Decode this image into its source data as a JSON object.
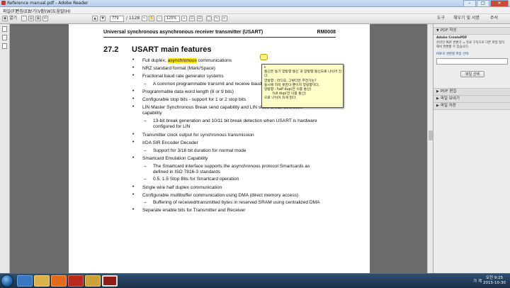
{
  "window": {
    "title": "Reference manual.pdf - Adobe Reader"
  },
  "menu": [
    "파일(F)",
    "편집(E)",
    "보기(V)",
    "창(W)",
    "도움말(H)"
  ],
  "toolbar": {
    "open_label": "열기",
    "page_current": "779",
    "page_total": "/ 1128",
    "zoom": "125%",
    "tools": "도구",
    "sign": "채우기 및 서명",
    "comment": "주석"
  },
  "document": {
    "header_left": "Universal synchronous asynchronous receiver transmitter (USART)",
    "header_right": "RM0008",
    "section_number": "27.2",
    "section_title": "USART main features",
    "items": [
      {
        "type": "bullet",
        "pre": "Full duplex, ",
        "highlight": "asynchronous",
        "post": " communications"
      },
      {
        "type": "bullet",
        "text": "NRZ standard format (Mark/Space)"
      },
      {
        "type": "bullet",
        "text": "Fractional baud rate generator systems"
      },
      {
        "type": "dash",
        "text": "A common programmable transmit and receive baud rate"
      },
      {
        "type": "bullet",
        "text": "Programmable data word length (8 or 9 bits)"
      },
      {
        "type": "bullet",
        "text": "Configurable stop bits - support for 1 or 2 stop bits"
      },
      {
        "type": "bullet",
        "text": "LIN Master Synchronous Break send capability and LIN slave break detection"
      },
      {
        "type": "cont",
        "text": "capability"
      },
      {
        "type": "dash",
        "text": "13-bit break generation and 10/11 bit break detection when USART is hardware"
      },
      {
        "type": "cont2",
        "text": "configured for LIN"
      },
      {
        "type": "bullet",
        "text": "Transmitter clock output for synchronous transmission"
      },
      {
        "type": "bullet",
        "text": "IrDA SIR Encoder Decoder"
      },
      {
        "type": "dash",
        "text": "Support for 3/16 bit duration for normal mode"
      },
      {
        "type": "bullet",
        "text": "Smartcard Emulation Capability"
      },
      {
        "type": "dash",
        "text": "The Smartcard interface supports the asynchronous protocol Smartcards as"
      },
      {
        "type": "cont2",
        "text": "defined in ISO 7816-3 standards"
      },
      {
        "type": "dash",
        "text": "0.5, 1.5 Stop Bits for Smartcard operation"
      },
      {
        "type": "bullet",
        "text": "Single wire half duplex communication"
      },
      {
        "type": "bullet",
        "text": "Configurable multibuffer communication using DMA (direct memory access)"
      },
      {
        "type": "dash",
        "text": "Buffering of received/transmitted bytes in reserved SRAM using centralized DMA"
      },
      {
        "type": "bullet",
        "text": "Separate enable bits for Transmitter and Receiver"
      }
    ]
  },
  "note_popup": {
    "author": "k",
    "line1": "통신은 동기 양방향 통신 과 양방향 통신으로 나뉘어 진다.",
    "line2": "양방향 : 라디오, 그렇다면 무전기는?",
    "line3": "동시에 하지 못한다 뿐이지 양방향이다.",
    "line4": "양방향 : half dup(전 이중 통신)",
    "line5": "full dup(전 이중 통신)",
    "line6": "으로 나뉘어 지게 된다."
  },
  "right_panel": {
    "tabs": [
      "도구",
      "채우기 및 서명",
      "주석"
    ],
    "pdf_create": "PDF 작성",
    "adobe_createpdf": "Adobe CreatePDF",
    "create_desc": "온라인 PDF 변환기 = 유료 구독으로 다른 파일 형식 에서 변환할 수 있습니다.",
    "select_label": "PDF로 변환할 파일 선택:",
    "select_button": "파일 선택",
    "pdf_edit": "PDF 편집",
    "file_send": "파일 보내기",
    "file_store": "파일 저장"
  },
  "taskbar": {
    "time": "오전 9:25",
    "date": "2015-10-30",
    "lang": "가 계",
    "apps": [
      "ie",
      "explorer",
      "media",
      "adobe",
      "explorer2",
      "reader"
    ]
  }
}
